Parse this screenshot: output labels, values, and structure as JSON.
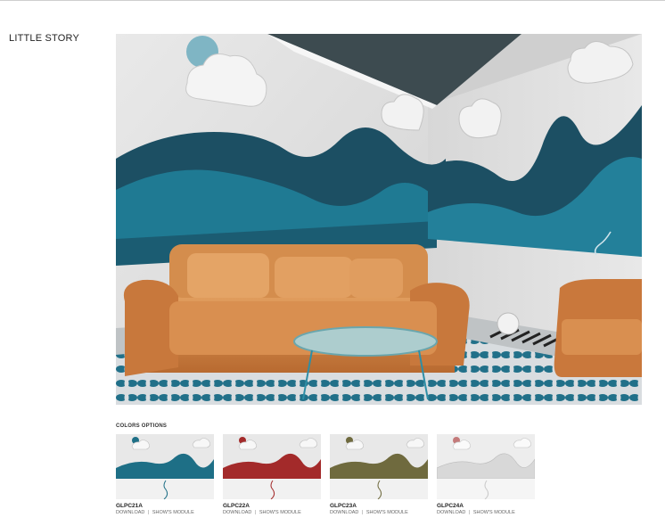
{
  "page": {
    "title": "LITTLE STORY"
  },
  "hero": {
    "icon": "room-photo"
  },
  "options": {
    "label": "COLORS OPTIONS",
    "items": [
      {
        "code": "GLPC21A",
        "download": "DOWNLOAD",
        "separator": "|",
        "module": "SHOW'S MODULE",
        "color": "#1e6f86"
      },
      {
        "code": "GLPC22A",
        "download": "DOWNLOAD",
        "separator": "|",
        "module": "SHOW'S MODULE",
        "color": "#a32a2a"
      },
      {
        "code": "GLPC23A",
        "download": "DOWNLOAD",
        "separator": "|",
        "module": "SHOW'S MODULE",
        "color": "#6f6a3e"
      },
      {
        "code": "GLPC24A",
        "download": "DOWNLOAD",
        "separator": "|",
        "module": "SHOW'S MODULE",
        "color": "#d8d8d8"
      }
    ]
  }
}
